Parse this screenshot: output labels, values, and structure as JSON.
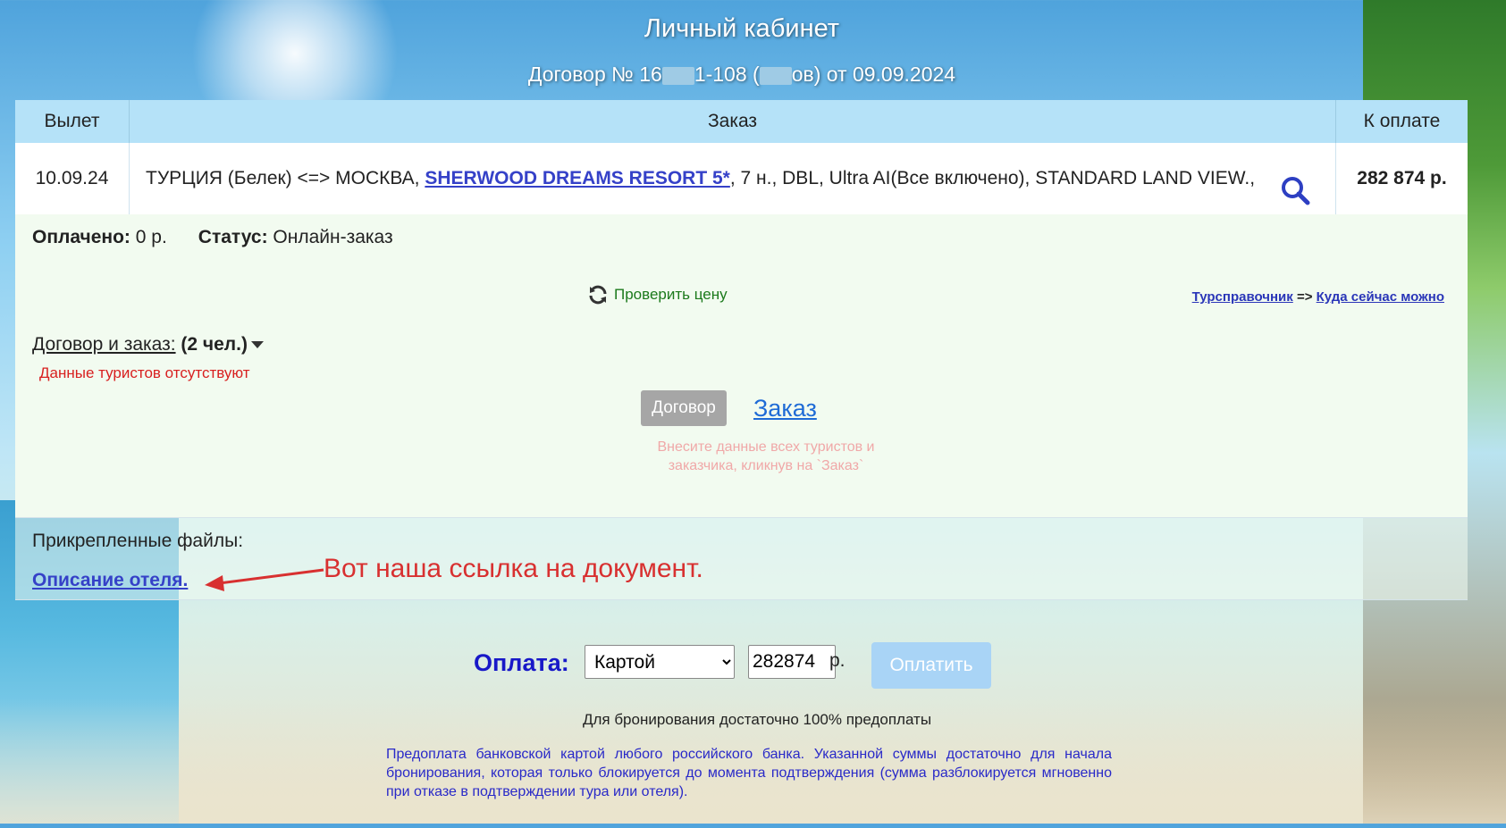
{
  "header": {
    "title": "Личный кабинет",
    "contract_prefix": "Договор № 16",
    "contract_mid": "1-108 (",
    "contract_suffix": "ов) от 09.09.2024"
  },
  "order_table": {
    "columns": [
      "Вылет",
      "Заказ",
      "К оплате"
    ],
    "row": {
      "departure": "10.09.24",
      "route": "ТУРЦИЯ (Белек) <=> МОСКВА, ",
      "hotel": "SHERWOOD DREAMS RESORT 5*",
      "details": ", 7 н., DBL, Ultra AI(Все включено), STANDARD LAND VIEW.,",
      "amount": "282 874 р."
    },
    "search_icon": "search-icon"
  },
  "info": {
    "paid_label": "Оплачено:",
    "paid_value": "0 р.",
    "status_label": "Статус:",
    "status_value": "Онлайн-заказ",
    "check_price": "Проверить цену",
    "refresh_icon": "refresh-icon",
    "guide_link": "Турсправочник",
    "guide_arrow": "=>",
    "where_now_link": "Куда сейчас можно",
    "contract_toggle_label": "Договор и заказ:",
    "contract_toggle_count": "(2 чел.)",
    "no_tourists": "Данные туристов отсутствуют",
    "contract_button": "Договор",
    "order_link": "Заказ",
    "hint": "Внесите данные всех туристов и заказчика, кликнув на `Заказ`"
  },
  "files": {
    "title": "Прикрепленные файлы:",
    "link": "Описание отеля.",
    "annotation": "Вот наша ссылка на документ."
  },
  "payment": {
    "label": "Оплата:",
    "method_selected": "Картой",
    "amount_value": "282874",
    "currency": "р.",
    "pay_button": "Оплатить",
    "prepay_note": "Для бронирования достаточно 100% предоплаты",
    "bank_note": "Предоплата банковской картой любого российского банка. Указанной суммы достаточно для начала бронирования, которая только блокируется до момента подтверждения (сумма разблокируется мгновенно при отказе в подтверждении тура или отеля)."
  },
  "colors": {
    "link_blue": "#3541c8",
    "pay_label": "#1818c8",
    "error_red": "#d82020",
    "annotation_red": "#d83030",
    "check_green": "#1c7a1c"
  }
}
